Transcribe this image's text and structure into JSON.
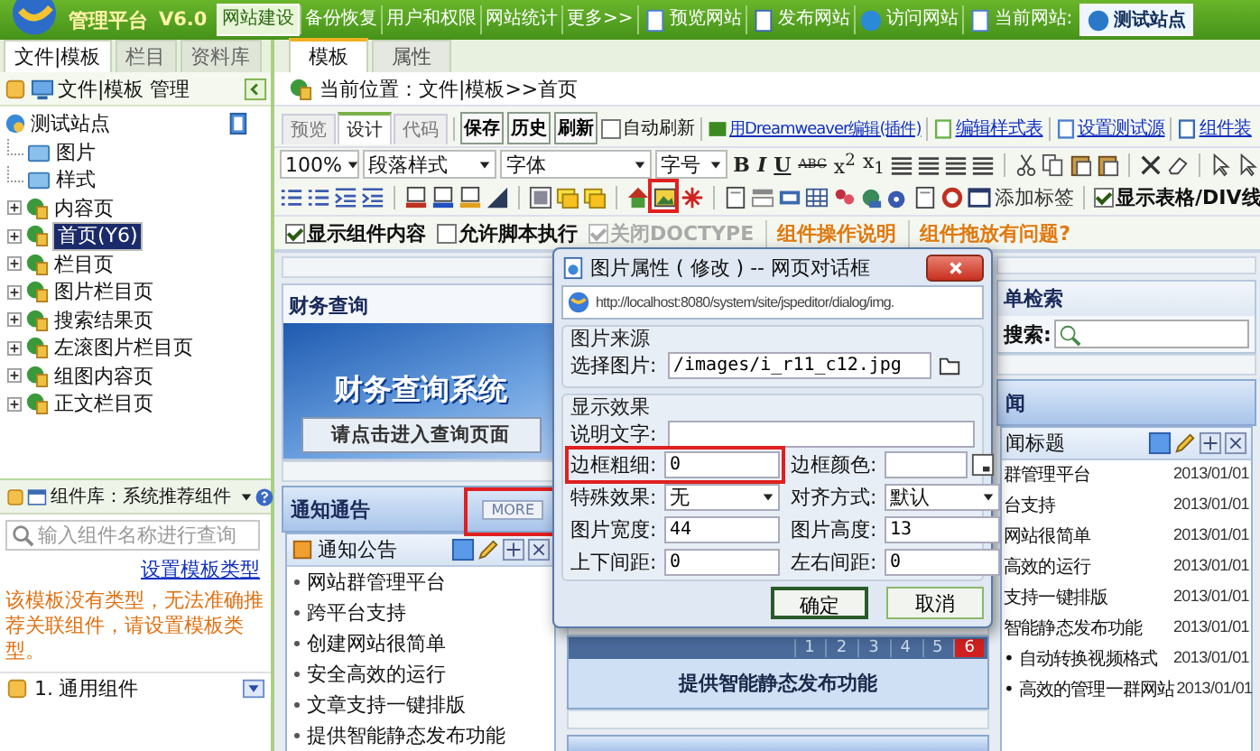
{
  "top_bar": {
    "title": "管理平台",
    "version": "V6.0",
    "nav": [
      {
        "label": "网站建设",
        "selected": true
      },
      {
        "label": "备份恢复",
        "selected": false
      },
      {
        "label": "用户和权限",
        "selected": false
      },
      {
        "label": "网站统计",
        "selected": false
      },
      {
        "label": "更多>>",
        "selected": false
      }
    ],
    "actions": [
      {
        "label": "预览网站",
        "kind": "page"
      },
      {
        "label": "发布网站",
        "kind": "publish"
      },
      {
        "label": "访问网站",
        "kind": "browser"
      }
    ],
    "current_site": {
      "label": "当前网站:",
      "value": "测试站点"
    }
  },
  "sidebar": {
    "tabs": [
      {
        "label": "文件|模板",
        "selected": true
      },
      {
        "label": "栏目",
        "selected": false
      },
      {
        "label": "资料库",
        "selected": false
      }
    ],
    "header": "文件|模板 管理",
    "tree": {
      "label": "测试站点",
      "children": [
        {
          "label": "图片",
          "kind": "folder",
          "selected": false
        },
        {
          "label": "样式",
          "kind": "folder",
          "selected": false
        },
        {
          "label": "内容页",
          "kind": "page",
          "expanded": false,
          "selected": false
        },
        {
          "label": "首页(Y6)",
          "kind": "page",
          "expanded": false,
          "selected": true
        },
        {
          "label": "栏目页",
          "kind": "page",
          "expanded": false,
          "selected": false
        },
        {
          "label": "图片栏目页",
          "kind": "page",
          "expanded": false,
          "selected": false
        },
        {
          "label": "搜索结果页",
          "kind": "page",
          "expanded": false,
          "selected": false
        },
        {
          "label": "左滚图片栏目页",
          "kind": "page",
          "expanded": false,
          "selected": false
        },
        {
          "label": "组图内容页",
          "kind": "page",
          "expanded": false,
          "selected": false
        },
        {
          "label": "正文栏目页",
          "kind": "page",
          "expanded": false,
          "selected": false
        }
      ]
    },
    "components": {
      "title": "组件库：系统推荐组件",
      "search_placeholder": "输入组件名称进行查询",
      "link": "设置模板类型",
      "warning": "该模板没有类型，无法准确推荐关联组件，请设置模板类型。",
      "groups": [
        {
          "number": "1.",
          "label": "通用组件",
          "expanded": false
        }
      ]
    }
  },
  "editor": {
    "tabs": [
      {
        "label": "模板",
        "selected": true
      },
      {
        "label": "属性",
        "selected": false
      }
    ],
    "breadcrumb": "当前位置：文件|模板>>首页",
    "view_tabs": [
      {
        "label": "预览",
        "selected": false
      },
      {
        "label": "设计",
        "selected": true
      },
      {
        "label": "代码",
        "selected": false
      }
    ],
    "buttons": [
      "保存",
      "历史",
      "刷新"
    ],
    "auto_refresh": {
      "label": "自动刷新",
      "checked": false
    },
    "links": [
      {
        "label": "用Dreamweaver编辑(插件)",
        "kind": "dreamweaver"
      },
      {
        "label": "编辑样式表",
        "kind": "stylesheet"
      },
      {
        "label": "设置测试源",
        "kind": "document"
      },
      {
        "label": "组件装",
        "kind": "window"
      }
    ],
    "selects": [
      "100%",
      "段落样式",
      "字体",
      "字号"
    ],
    "format_buttons": [
      {
        "label": "B",
        "kind": "bold"
      },
      {
        "label": "I",
        "kind": "italic"
      },
      {
        "label": "U",
        "kind": "underline"
      },
      {
        "label": "ABC",
        "kind": "strike"
      },
      {
        "label": "x$^{2}$",
        "kind": "rich"
      },
      {
        "label": "x$_{1}$",
        "kind": "rich"
      }
    ],
    "image_icon_highlighted": true,
    "add_tag": "添加标签",
    "show_grid": {
      "label": "显示表格/DIV线",
      "checked": true
    },
    "options": [
      {
        "label": "显示组件内容",
        "checked": true,
        "disabled": false
      },
      {
        "label": "允许脚本执行",
        "checked": false,
        "disabled": false
      },
      {
        "label": "关闭DOCTYPE",
        "checked": true,
        "disabled": true
      }
    ],
    "help_links": [
      "组件操作说明",
      "组件拖放有问题?"
    ]
  },
  "canvas": {
    "finance": {
      "title": "财务查询",
      "banner": "财务查询系统",
      "button": "请点击进入查询页面"
    },
    "notice": {
      "title": "通知通告",
      "more": "MORE",
      "more_highlighted": true,
      "list_title": "通知公告",
      "items": [
        "网站群管理平台",
        "跨平台支持",
        "创建网站很简单",
        "安全高效的运行",
        "文章支持一键排版",
        "提供智能静态发布功能"
      ]
    },
    "slideshow": {
      "pages": [
        {
          "label": "1",
          "selected": false
        },
        {
          "label": "2",
          "selected": false
        },
        {
          "label": "3",
          "selected": false
        },
        {
          "label": "4",
          "selected": false
        },
        {
          "label": "5",
          "selected": false
        },
        {
          "label": "6",
          "selected": true
        }
      ],
      "caption": "提供智能静态发布功能"
    },
    "search": {
      "title": "单检索",
      "label": "搜索:"
    },
    "news": {
      "title": "闻",
      "list_title": "闻标题",
      "items": [
        {
          "title": "群管理平台",
          "date": "2013/01/01"
        },
        {
          "title": "台支持",
          "date": "2013/01/01"
        },
        {
          "title": "网站很简单",
          "date": "2013/01/01"
        },
        {
          "title": "高效的运行",
          "date": "2013/01/01"
        },
        {
          "title": "支持一键排版",
          "date": "2013/01/01"
        },
        {
          "title": "智能静态发布功能",
          "date": "2013/01/01"
        },
        {
          "title": "• 自动转换视频格式",
          "date": "2013/01/01"
        },
        {
          "title": "• 高效的管理一群网站",
          "date": "2013/01/01"
        }
      ]
    }
  },
  "dialog": {
    "title": "图片属性 ( 修改 ) -- 网页对话框",
    "url": "http://localhost:8080/system/site/jspeditor/dialog/img.",
    "source": {
      "legend": "图片来源",
      "label": "选择图片:",
      "value": "/images/i_r11_c12.jpg"
    },
    "display": {
      "legend": "显示效果",
      "caption_label": "说明文字:",
      "fields": [
        {
          "label": "边框粗细:",
          "kind": "text",
          "value": "0",
          "highlighted": true
        },
        {
          "label": "边框颜色:",
          "kind": "color",
          "highlighted": false
        },
        {
          "label": "特殊效果:",
          "kind": "select",
          "value": "无",
          "highlighted": false
        },
        {
          "label": "对齐方式:",
          "kind": "select",
          "value": "默认",
          "highlighted": false
        },
        {
          "label": "图片宽度:",
          "kind": "text",
          "value": "44",
          "highlighted": false
        },
        {
          "label": "图片高度:",
          "kind": "text",
          "value": "13",
          "highlighted": false
        },
        {
          "label": "上下间距:",
          "kind": "text",
          "value": "0",
          "highlighted": false
        },
        {
          "label": "左右间距:",
          "kind": "text",
          "value": "0",
          "highlighted": false
        }
      ]
    },
    "buttons": [
      {
        "label": "确定",
        "default": true
      },
      {
        "label": "取消",
        "default": false
      }
    ]
  }
}
